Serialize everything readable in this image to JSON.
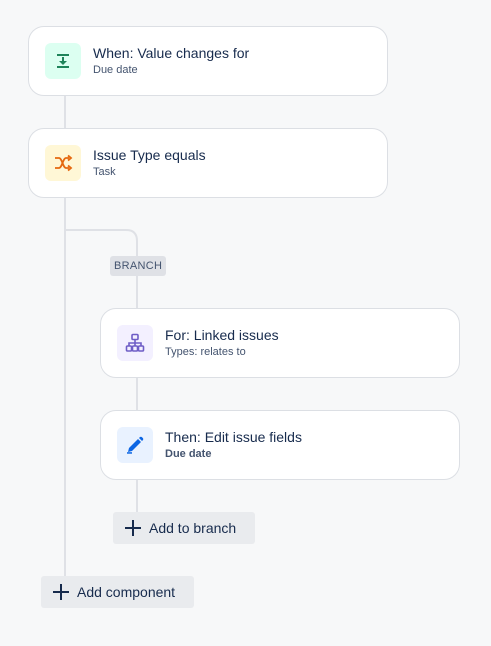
{
  "trigger": {
    "title": "When: Value changes for",
    "subtitle": "Due date",
    "icon": "download-arrow-icon",
    "icon_color": "#1f845a",
    "icon_bg": "#dcfff1"
  },
  "condition": {
    "title": "Issue Type equals",
    "subtitle": "Task",
    "icon": "shuffle-icon",
    "icon_color": "#e56910",
    "icon_bg": "#fff7d6"
  },
  "branch": {
    "label": "BRANCH",
    "for_card": {
      "title": "For: Linked issues",
      "subtitle": "Types: relates to",
      "icon": "hierarchy-icon",
      "icon_color": "#6e5dc6",
      "icon_bg": "#f3f0ff"
    },
    "then_card": {
      "title": "Then: Edit issue fields",
      "subtitle": "Due date",
      "icon": "pencil-icon",
      "icon_color": "#0c66e4",
      "icon_bg": "#e9f2ff"
    },
    "add_label": "Add to branch"
  },
  "add_component_label": "Add component",
  "colors": {
    "background": "#f7f8f9",
    "connector": "#dfe1e6",
    "card_border": "#dcdfe4"
  }
}
